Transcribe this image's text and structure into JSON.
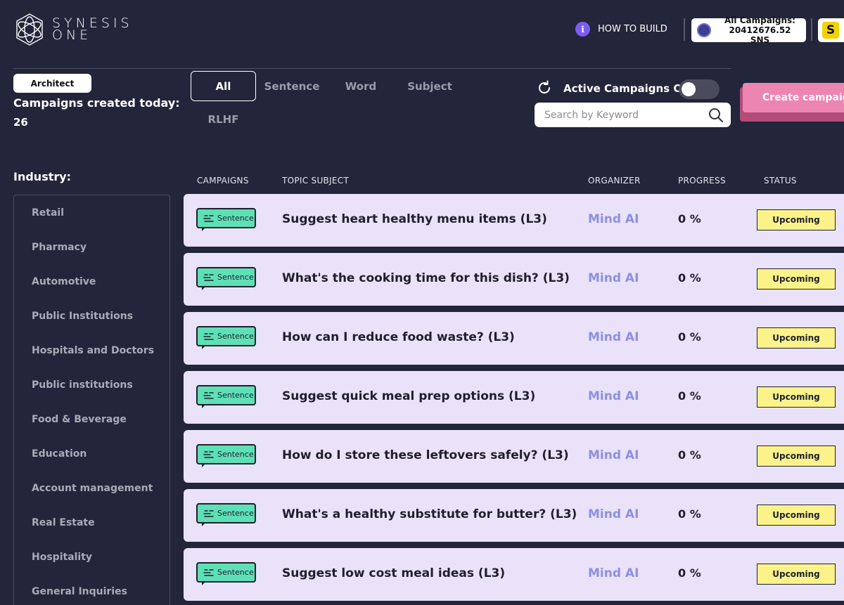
{
  "brand": {
    "line1": "SYNESIS",
    "line2": "ONE"
  },
  "header": {
    "how_to_build": "HOW TO BUILD",
    "info_glyph": "i",
    "wallet_line1": "All Campaigns:",
    "wallet_line2": "20412676.52 SNS",
    "brand_glyph": "S"
  },
  "user": {
    "role": "Architect",
    "created_label": "Campaigns created today:",
    "created_count": "26"
  },
  "tabs": [
    "All",
    "Sentence",
    "Word",
    "Subject",
    "RLHF"
  ],
  "filters": {
    "active_only_label": "Active Campaigns Only",
    "active_only": false,
    "search_placeholder": "Search by Keyword"
  },
  "create_button": "Create campaign",
  "industry": {
    "title": "Industry:",
    "items": [
      "Retail",
      "Pharmacy",
      "Automotive",
      "Public Institutions",
      "Hospitals and Doctors",
      "Public institutions",
      "Food & Beverage",
      "Education",
      "Account management",
      "Real Estate",
      "Hospitality",
      "General Inquiries"
    ]
  },
  "table": {
    "headers": [
      "CAMPAIGNS",
      "TOPIC SUBJECT",
      "ORGANIZER",
      "PROGRESS",
      "STATUS"
    ],
    "rows": [
      {
        "type": "Sentence",
        "topic": "Suggest heart healthy menu items (L3)",
        "organizer": "Mind AI",
        "progress": "0 %",
        "status": "Upcoming"
      },
      {
        "type": "Sentence",
        "topic": "What's the cooking time for this dish? (L3)",
        "organizer": "Mind AI",
        "progress": "0 %",
        "status": "Upcoming"
      },
      {
        "type": "Sentence",
        "topic": "How can I reduce food waste? (L3)",
        "organizer": "Mind AI",
        "progress": "0 %",
        "status": "Upcoming"
      },
      {
        "type": "Sentence",
        "topic": "Suggest quick meal prep options (L3)",
        "organizer": "Mind AI",
        "progress": "0 %",
        "status": "Upcoming"
      },
      {
        "type": "Sentence",
        "topic": "How do I store these leftovers safely? (L3)",
        "organizer": "Mind AI",
        "progress": "0 %",
        "status": "Upcoming"
      },
      {
        "type": "Sentence",
        "topic": "What's a healthy substitute for butter? (L3)",
        "organizer": "Mind AI",
        "progress": "0 %",
        "status": "Upcoming"
      },
      {
        "type": "Sentence",
        "topic": "Suggest low cost meal ideas (L3)",
        "organizer": "Mind AI",
        "progress": "0 %",
        "status": "Upcoming"
      }
    ]
  },
  "colors": {
    "background": "#23253a",
    "row_bg": "#eae2f8",
    "tag_green": "#5ee0b6",
    "status_yellow": "#fbf38a",
    "organizer_purple": "#8d8fe0",
    "create_pink": "#ec85b2",
    "info_purple": "#7c5cf0"
  },
  "icons": {
    "logo": "synesis-flower-logo",
    "info": "info-icon",
    "wallet": "sns-token-icon",
    "brand": "synesis-s-icon",
    "refresh": "refresh-icon",
    "search": "search-icon",
    "tag": "speech-bubble-icon"
  }
}
